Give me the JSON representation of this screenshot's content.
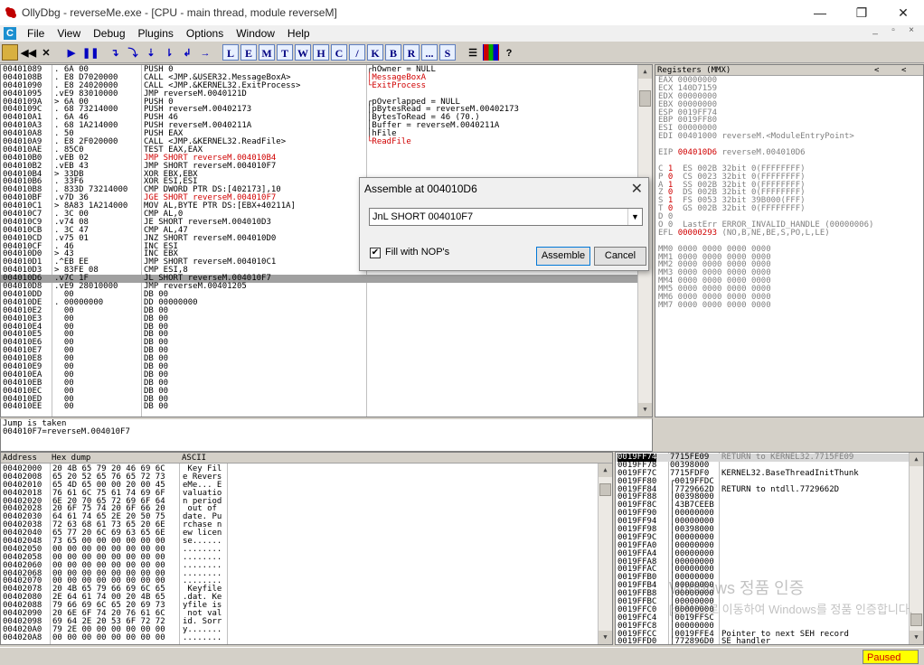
{
  "window": {
    "title": "OllyDbg - reverseMe.exe - [CPU - main thread, module reverseM]",
    "minimize": "—",
    "restore": "❐",
    "close": "✕"
  },
  "menu": {
    "mdi_icon": "C",
    "items": [
      "File",
      "View",
      "Debug",
      "Plugins",
      "Options",
      "Window",
      "Help"
    ],
    "mdi_controls": [
      "_",
      "▫",
      "×"
    ]
  },
  "toolbar": {
    "buttons": [
      "open-icon",
      "rewind-icon",
      "close-icon",
      "run-icon",
      "pause-icon",
      "step-into-icon",
      "step-over-icon",
      "trace-into-icon",
      "trace-over-icon",
      "execute-till-return-icon",
      "go-to-icon"
    ],
    "letters": [
      "L",
      "E",
      "M",
      "T",
      "W",
      "H",
      "C",
      "/",
      "K",
      "B",
      "R",
      "...",
      "S"
    ],
    "extra": [
      "list-icon",
      "grid-icon",
      "help-icon"
    ]
  },
  "cpu": {
    "rows": [
      [
        "00401089",
        ". 6A 00",
        "PUSH 0",
        "",
        ""
      ],
      [
        "0040108B",
        ". E8 D7020000",
        "CALL <JMP.&USER32.MessageBoxA>",
        "",
        ""
      ],
      [
        "00401090",
        ". E8 24020000",
        "CALL <JMP.&KERNEL32.ExitProcess>",
        "",
        ""
      ],
      [
        "00401095",
        ".vE9 83010000",
        "JMP reverseM.0040121D",
        "",
        ""
      ],
      [
        "0040109A",
        "> 6A 00",
        "PUSH 0",
        "",
        ""
      ],
      [
        "0040109C",
        ". 68 73214000",
        "PUSH reverseM.00402173",
        "",
        ""
      ],
      [
        "004010A1",
        ". 6A 46",
        "PUSH 46",
        "",
        ""
      ],
      [
        "004010A3",
        ". 68 1A214000",
        "PUSH reverseM.0040211A",
        "",
        ""
      ],
      [
        "004010A8",
        ". 50",
        "PUSH EAX",
        "",
        ""
      ],
      [
        "004010A9",
        ". E8 2F020000",
        "CALL <JMP.&KERNEL32.ReadFile>",
        "",
        ""
      ],
      [
        "004010AE",
        ". 85C0",
        "TEST EAX,EAX",
        "",
        ""
      ],
      [
        "004010B0",
        ".vEB 02",
        "JMP SHORT reverseM.004010B4",
        "red",
        ""
      ],
      [
        "004010B2",
        ".vEB 43",
        "JMP SHORT reverseM.004010F7",
        "",
        ""
      ],
      [
        "004010B4",
        "> 33DB",
        "XOR EBX,EBX",
        "",
        ""
      ],
      [
        "004010B6",
        ". 33F6",
        "XOR ESI,ESI",
        "",
        ""
      ],
      [
        "004010B8",
        ". 833D 73214000",
        "CMP DWORD PTR DS:[402173],10",
        "",
        ""
      ],
      [
        "004010BF",
        ".v7D 36",
        "JGE SHORT reverseM.004010F7",
        "red",
        ""
      ],
      [
        "004010C1",
        "> 8A83 1A214000",
        "MOV AL,BYTE PTR DS:[EBX+40211A]",
        "",
        ""
      ],
      [
        "004010C7",
        ". 3C 00",
        "CMP AL,0",
        "",
        ""
      ],
      [
        "004010C9",
        ".v74 08",
        "JE SHORT reverseM.004010D3",
        "",
        ""
      ],
      [
        "004010CB",
        ". 3C 47",
        "CMP AL,47",
        "",
        ""
      ],
      [
        "004010CD",
        ".v75 01",
        "JNZ SHORT reverseM.004010D0",
        "",
        ""
      ],
      [
        "004010CF",
        ". 46",
        "INC ESI",
        "",
        ""
      ],
      [
        "004010D0",
        "> 43",
        "INC EBX",
        "",
        ""
      ],
      [
        "004010D1",
        ".^EB EE",
        "JMP SHORT reverseM.004010C1",
        "",
        ""
      ],
      [
        "004010D3",
        "> 83FE 08",
        "CMP ESI,8",
        "",
        ""
      ],
      [
        "004010D6",
        ".v7C 1F",
        "JL SHORT reverseM.004010F7",
        "",
        "sel"
      ],
      [
        "004010D8",
        ".vE9 28010000",
        "JMP reverseM.00401205",
        "",
        ""
      ],
      [
        "004010DD",
        "  00",
        "DB 00",
        "",
        ""
      ],
      [
        "004010DE",
        ". 00000000",
        "DD 00000000",
        "",
        ""
      ],
      [
        "004010E2",
        "  00",
        "DB 00",
        "",
        ""
      ],
      [
        "004010E3",
        "  00",
        "DB 00",
        "",
        ""
      ],
      [
        "004010E4",
        "  00",
        "DB 00",
        "",
        ""
      ],
      [
        "004010E5",
        "  00",
        "DB 00",
        "",
        ""
      ],
      [
        "004010E6",
        "  00",
        "DB 00",
        "",
        ""
      ],
      [
        "004010E7",
        "  00",
        "DB 00",
        "",
        ""
      ],
      [
        "004010E8",
        "  00",
        "DB 00",
        "",
        ""
      ],
      [
        "004010E9",
        "  00",
        "DB 00",
        "",
        ""
      ],
      [
        "004010EA",
        "  00",
        "DB 00",
        "",
        ""
      ],
      [
        "004010EB",
        "  00",
        "DB 00",
        "",
        ""
      ],
      [
        "004010EC",
        "  00",
        "DB 00",
        "",
        ""
      ],
      [
        "004010ED",
        "  00",
        "DB 00",
        "",
        ""
      ],
      [
        "004010EE",
        "  00",
        "DB 00",
        "",
        ""
      ]
    ],
    "comments": [
      {
        "row": 0,
        "text": "┌hOwner = NULL",
        "color": "black"
      },
      {
        "row": 1,
        "text": "│MessageBoxA",
        "color": "red"
      },
      {
        "row": 2,
        "text": "└ExitProcess",
        "color": "red"
      },
      {
        "row": 4,
        "text": "┌pOverlapped = NULL",
        "color": "black"
      },
      {
        "row": 5,
        "text": "│pBytesRead = reverseM.00402173",
        "color": "black"
      },
      {
        "row": 6,
        "text": "│BytesToRead = 46 (70.)",
        "color": "black"
      },
      {
        "row": 7,
        "text": "│Buffer = reverseM.0040211A",
        "color": "black"
      },
      {
        "row": 8,
        "text": "│hFile",
        "color": "black"
      },
      {
        "row": 9,
        "text": "└ReadFile",
        "color": "red"
      }
    ]
  },
  "info": {
    "line1": "Jump is taken",
    "line2": "004010F7=reverseM.004010F7"
  },
  "registers": {
    "header": "Registers (MMX)",
    "nav": [
      "<",
      "<"
    ],
    "lines": [
      {
        "t": "EAX 00000000",
        "c": "gray"
      },
      {
        "t": "ECX 140D7159",
        "c": "gray"
      },
      {
        "t": "EDX 00000000",
        "c": "gray"
      },
      {
        "t": "EBX 00000000",
        "c": "gray"
      },
      {
        "t": "ESP 0019FF74",
        "c": "gray"
      },
      {
        "t": "EBP 0019FF80",
        "c": "gray"
      },
      {
        "t": "ESI 00000000",
        "c": "gray"
      },
      {
        "t": "EDI 00401000 reverseM.<ModuleEntryPoint>",
        "c": "gray"
      },
      {
        "t": "",
        "c": "gray"
      },
      {
        "t": "EIP 004010D6 reverseM.004010D6",
        "c": "eip"
      },
      {
        "t": "",
        "c": "gray"
      },
      {
        "t": "C 1  ES 002B 32bit 0(FFFFFFFF)",
        "c": "flag"
      },
      {
        "t": "P 0  CS 0023 32bit 0(FFFFFFFF)",
        "c": "flag"
      },
      {
        "t": "A 1  SS 002B 32bit 0(FFFFFFFF)",
        "c": "flag"
      },
      {
        "t": "Z 0  DS 002B 32bit 0(FFFFFFFF)",
        "c": "flag"
      },
      {
        "t": "S 1  FS 0053 32bit 39B000(FFF)",
        "c": "flag"
      },
      {
        "t": "T 0  GS 002B 32bit 0(FFFFFFFF)",
        "c": "flag"
      },
      {
        "t": "D 0",
        "c": "gray"
      },
      {
        "t": "O 0  LastErr ERROR_INVALID_HANDLE (00000006)",
        "c": "gray"
      },
      {
        "t": "EFL 00000293 (NO,B,NE,BE,S,PO,L,LE)",
        "c": "efl"
      },
      {
        "t": "",
        "c": "gray"
      },
      {
        "t": "MM0 0000 0000 0000 0000",
        "c": "gray"
      },
      {
        "t": "MM1 0000 0000 0000 0000",
        "c": "gray"
      },
      {
        "t": "MM2 0000 0000 0000 0000",
        "c": "gray"
      },
      {
        "t": "MM3 0000 0000 0000 0000",
        "c": "gray"
      },
      {
        "t": "MM4 0000 0000 0000 0000",
        "c": "gray"
      },
      {
        "t": "MM5 0000 0000 0000 0000",
        "c": "gray"
      },
      {
        "t": "MM6 0000 0000 0000 0000",
        "c": "gray"
      },
      {
        "t": "MM7 0000 0000 0000 0000",
        "c": "gray"
      }
    ]
  },
  "dump": {
    "headers": [
      "Address",
      "Hex dump",
      "ASCII"
    ],
    "rows": [
      [
        "00402000",
        "20 4B 65 79 20 46 69 6C",
        " Key Fil"
      ],
      [
        "00402008",
        "65 20 52 65 76 65 72 73",
        "e Revers"
      ],
      [
        "00402010",
        "65 4D 65 00 00 20 00 45",
        "eMe... E"
      ],
      [
        "00402018",
        "76 61 6C 75 61 74 69 6F",
        "valuatio"
      ],
      [
        "00402020",
        "6E 20 70 65 72 69 6F 64",
        "n period"
      ],
      [
        "00402028",
        "20 6F 75 74 20 6F 66 20",
        " out of "
      ],
      [
        "00402030",
        "64 61 74 65 2E 20 50 75",
        "date. Pu"
      ],
      [
        "00402038",
        "72 63 68 61 73 65 20 6E",
        "rchase n"
      ],
      [
        "00402040",
        "65 77 20 6C 69 63 65 6E",
        "ew licen"
      ],
      [
        "00402048",
        "73 65 00 00 00 00 00 00",
        "se......"
      ],
      [
        "00402050",
        "00 00 00 00 00 00 00 00",
        "........"
      ],
      [
        "00402058",
        "00 00 00 00 00 00 00 00",
        "........"
      ],
      [
        "00402060",
        "00 00 00 00 00 00 00 00",
        "........"
      ],
      [
        "00402068",
        "00 00 00 00 00 00 00 00",
        "........"
      ],
      [
        "00402070",
        "00 00 00 00 00 00 00 00",
        "........"
      ],
      [
        "00402078",
        "20 4B 65 79 66 69 6C 65",
        " Keyfile"
      ],
      [
        "00402080",
        "2E 64 61 74 00 20 4B 65",
        ".dat. Ke"
      ],
      [
        "00402088",
        "79 66 69 6C 65 20 69 73",
        "yfile is"
      ],
      [
        "00402090",
        "20 6E 6F 74 20 76 61 6C",
        " not val"
      ],
      [
        "00402098",
        "69 64 2E 20 53 6F 72 72",
        "id. Sorr"
      ],
      [
        "004020A0",
        "79 2E 00 00 00 00 00 00",
        "y......."
      ],
      [
        "004020A8",
        "00 00 00 00 00 00 00 00",
        "........"
      ]
    ]
  },
  "stack": {
    "rows": [
      [
        "0019FF74",
        "7715FE09",
        "RETURN to KERNEL32.7715FE09",
        "sel"
      ],
      [
        "0019FF78",
        "00398000",
        "",
        ""
      ],
      [
        "0019FF7C",
        "7715FDF0",
        "KERNEL32.BaseThreadInitThunk",
        ""
      ],
      [
        "0019FF80",
        "┌0019FFDC",
        "",
        ""
      ],
      [
        "0019FF84",
        "│7729662D",
        "RETURN to ntdll.7729662D",
        ""
      ],
      [
        "0019FF88",
        "│00398000",
        "",
        ""
      ],
      [
        "0019FF8C",
        "│43B7CEEB",
        "",
        ""
      ],
      [
        "0019FF90",
        "│00000000",
        "",
        ""
      ],
      [
        "0019FF94",
        "│00000000",
        "",
        ""
      ],
      [
        "0019FF98",
        "│00398000",
        "",
        ""
      ],
      [
        "0019FF9C",
        "│00000000",
        "",
        ""
      ],
      [
        "0019FFA0",
        "│00000000",
        "",
        ""
      ],
      [
        "0019FFA4",
        "│00000000",
        "",
        ""
      ],
      [
        "0019FFA8",
        "│00000000",
        "",
        ""
      ],
      [
        "0019FFAC",
        "│00000000",
        "",
        ""
      ],
      [
        "0019FFB0",
        "│00000000",
        "",
        ""
      ],
      [
        "0019FFB4",
        "│00000000",
        "",
        ""
      ],
      [
        "0019FFB8",
        "│00000000",
        "",
        ""
      ],
      [
        "0019FFBC",
        "│00000000",
        "",
        ""
      ],
      [
        "0019FFC0",
        "│00000000",
        "",
        ""
      ],
      [
        "0019FFC4",
        "│0019FFSC",
        "",
        ""
      ],
      [
        "0019FFC8",
        "│00000000",
        "",
        ""
      ],
      [
        "0019FFCC",
        "│0019FFE4",
        "Pointer to next SEH record",
        ""
      ],
      [
        "0019FFD0",
        "│772896D0",
        "SE handler",
        ""
      ]
    ]
  },
  "dialog": {
    "title": "Assemble at 004010D6",
    "close": "✕",
    "input_value": "JnL SHORT 004010F7",
    "dropdown_arrow": "▼",
    "checkbox_label": "Fill with NOP's",
    "checkbox_mark": "✔",
    "assemble_label": "Assemble",
    "cancel_label": "Cancel"
  },
  "watermark": {
    "line1": "Windows 정품 인증",
    "line2": "[설정]으로 이동하여 Windows를 정품 인증합니다."
  },
  "status": {
    "state": "Paused"
  },
  "colors": {
    "accent_red": "#d00000",
    "paused_bg": "#ffff00",
    "selection": "#a0a0a0"
  }
}
